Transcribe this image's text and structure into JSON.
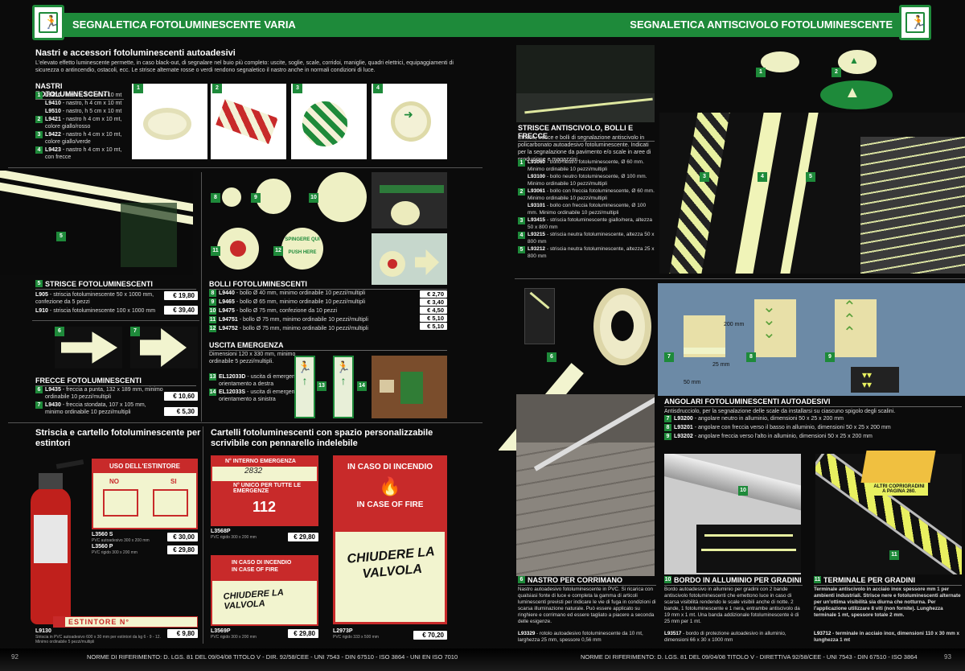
{
  "header": {
    "left_title": "SEGNALETICA FOTOLUMINESCENTE VARIA",
    "right_title": "SEGNALETICA ANTISCIVOLO FOTOLUMINESCENTE"
  },
  "intro": {
    "title": "Nastri e accessori fotoluminescenti autoadesivi",
    "text": "L'elevato effetto luminescente permette, in caso black-out, di segnalare nel buio più completo: uscite, soglie, scale, corridoi, maniglie, quadri elettrici, equipaggiamenti di sicurezza o antincendio, ostacoli, ecc. Le strisce alternate rosse o verdi rendono segnaletico il nastro anche in normali condizioni di luce."
  },
  "nastri": {
    "title": "NASTRI FOTOLUMINESCENTI",
    "items": [
      {
        "n": "1",
        "code": "L9210",
        "desc": "- nastro, h 2 cm x 10 mt"
      },
      {
        "n": "",
        "code": "L9410",
        "desc": "- nastro, h 4 cm x 10 mt"
      },
      {
        "n": "",
        "code": "L9510",
        "desc": "- nastro, h 5 cm x 10 mt"
      },
      {
        "n": "2",
        "code": "L9421",
        "desc": "- nastro h 4 cm x 10 mt, colore giallo/rosso"
      },
      {
        "n": "3",
        "code": "L9422",
        "desc": "- nastro h 4 cm x 10 mt, colore giallo/verde"
      },
      {
        "n": "4",
        "code": "L9423",
        "desc": "- nastro h 4 cm x 10 mt, con frecce"
      }
    ],
    "photo_tags": [
      "1",
      "2",
      "3",
      "4"
    ]
  },
  "strisce": {
    "tag": "5",
    "title": "STRISCE FOTOLUMINESCENTI",
    "items": [
      {
        "code": "L905",
        "desc": "- striscia fotoluminescente 50 x 1000 mm, confezione da 5 pezzi",
        "price": "€ 19,80"
      },
      {
        "code": "L910",
        "desc": "- striscia fotoluminescente 100 x 1000 mm",
        "price": "€ 39,40"
      }
    ]
  },
  "bolli": {
    "title": "BOLLI FOTOLUMINESCENTI",
    "tags": [
      "8",
      "9",
      "10",
      "11",
      "12"
    ],
    "push_text": "SPINGERE QUI",
    "push_text2": "PUSH HERE",
    "items": [
      {
        "n": "8",
        "code": "L9440",
        "desc": "- bollo Ø 40 mm, minimo ordinabile 10 pezzi/multipli",
        "price": "€ 2,70"
      },
      {
        "n": "9",
        "code": "L9465",
        "desc": "- bollo Ø 65 mm, minimo ordinabile 10 pezzi/multipli",
        "price": "€ 3,40"
      },
      {
        "n": "10",
        "code": "L9475",
        "desc": "- bollo Ø 75 mm, confezione da 10 pezzi",
        "price": "€ 4,50"
      },
      {
        "n": "11",
        "code": "L94751",
        "desc": "- bollo Ø 75 mm, minimo ordinabile 10 pezzi/multipli",
        "price": "€ 5,10"
      },
      {
        "n": "12",
        "code": "L94752",
        "desc": "- bollo Ø 75 mm, minimo ordinabile 10 pezzi/multipli",
        "price": "€ 5,10"
      }
    ]
  },
  "frecce": {
    "tags": [
      "6",
      "7"
    ],
    "title": "FRECCE FOTOLUMINESCENTI",
    "items": [
      {
        "n": "6",
        "code": "L9435",
        "desc": "- freccia a punta, 132 x 189 mm, minimo ordinabile 10 pezzi/multipli",
        "price": "€ 10,60"
      },
      {
        "n": "7",
        "code": "L9430",
        "desc": "- freccia stondata, 107 x 105 mm, minimo ordinabile 10 pezzi/multipli",
        "price": "€ 5,30"
      }
    ]
  },
  "uscita": {
    "title": "USCITA EMERGENZA",
    "text": "Dimensioni 120 x 330 mm, minimo ordinabile 5 pezzi/multipli.",
    "tags": [
      "13",
      "14"
    ],
    "items": [
      {
        "n": "13",
        "code": "EL12033D",
        "desc": "- uscita di emergenza, orientamento a destra"
      },
      {
        "n": "14",
        "code": "EL12033S",
        "desc": "- uscita di emergenza, orientamento a sinistra"
      }
    ]
  },
  "estintori": {
    "title": "Striscia e cartello fotoluminescente per estintori",
    "sign_title": "USO DELL'ESTINTORE",
    "no": "NO",
    "si": "SI",
    "tag": "ESTINTORE",
    "items": [
      {
        "code": "L3560 S",
        "desc": "PVC autoadesivo 300 x 200 mm",
        "price": "€ 30,00"
      },
      {
        "code": "L3560 P",
        "desc": "PVC rigido 300 x 200 mm",
        "price": "€ 29,80"
      }
    ],
    "strip": "ESTINTORE N°",
    "strip_code": "L9130",
    "strip_desc": "Striscia in PVC autoadesivo 600 x 30 mm per estintori da kg 6 - 9 - 12. Minimo ordinabile 5 pezzi/multipli",
    "strip_price": "€ 9,80"
  },
  "cartelli": {
    "title": "Cartelli fotoluminescenti con spazio personalizzabile scrivibile con pennarello indelebile",
    "s1": {
      "l1": "N° INTERNO EMERGENZA",
      "handwrite": "2832",
      "l2": "N° UNICO PER TUTTE LE EMERGENZE",
      "number": "112",
      "code": "L3568P",
      "desc": "PVC rigido 300 x 200 mm",
      "price": "€ 29,80"
    },
    "s2": {
      "l1": "IN CASO DI INCENDIO",
      "l2": "IN CASE OF FIRE",
      "handwrite": "CHIUDERE LA VALVOLA",
      "code": "L3569P",
      "desc": "PVC rigido 300 x 200 mm",
      "price": "€ 29,80"
    },
    "s3": {
      "l1": "IN CASO DI INCENDIO",
      "l2": "IN CASE OF FIRE",
      "handwrite": "CHIUDERE LA VALVOLA",
      "code": "L2973P",
      "desc": "PVC rigido 333 x 500 mm",
      "price": "€ 70,20"
    }
  },
  "antiscivolo": {
    "tags": [
      "1",
      "2",
      "3",
      "4",
      "5"
    ],
    "title": "STRISCE ANTISCIVOLO, BOLLI E FRECCE",
    "text": "Strisce, frecce e bolli di segnalazione antiscivolo in policarbonato autoadesivo fotoluminescente. Indicati per la segnalazione da pavimento e/o scale in aree di produzione e magazzini.",
    "items": [
      {
        "n": "1",
        "code": "L93060",
        "desc": "- bollo neutro fotoluminescente, Ø 60 mm. Minimo ordinabile 10 pezzi/multipli"
      },
      {
        "n": "",
        "code": "L93100",
        "desc": "- bollo neutro fotoluminescente, Ø 100 mm. Minimo ordinabile 10 pezzi/multipli"
      },
      {
        "n": "2",
        "code": "L93061",
        "desc": "- bollo con freccia fotoluminescente, Ø 60 mm. Minimo ordinabile 10 pezzi/multipli"
      },
      {
        "n": "",
        "code": "L93101",
        "desc": "- bollo con freccia fotoluminescente, Ø 100 mm. Minimo ordinabile 10 pezzi/multipli"
      },
      {
        "n": "3",
        "code": "L93415",
        "desc": "- striscia fotoluminescente giallo/nera, altezza 50 x 800 mm"
      },
      {
        "n": "4",
        "code": "L93215",
        "desc": "- striscia neutra fotoluminescente, altezza 50 x 800 mm"
      },
      {
        "n": "5",
        "code": "L93212",
        "desc": "- striscia neutra fotoluminescente, altezza 25 x 800 mm"
      }
    ]
  },
  "angolari": {
    "tags": [
      "7",
      "8",
      "9"
    ],
    "dims": [
      "200 mm",
      "25 mm",
      "50 mm"
    ],
    "title": "ANGOLARI FOTOLUMINESCENTI AUTOADESIVI",
    "text": "Antisdrucciolo, per la segnalazione delle scale da installarsi su ciascuno spigolo degli scalini.",
    "items": [
      {
        "n": "7",
        "code": "L93200",
        "desc": "- angolare neutro in alluminio, dimensioni 50 x 25 x 200 mm"
      },
      {
        "n": "8",
        "code": "L93201",
        "desc": "- angolare con freccia verso il basso in alluminio, dimensioni 50 x 25 x 200 mm"
      },
      {
        "n": "9",
        "code": "L93202",
        "desc": "- angolare freccia verso l'alto in alluminio, dimensioni 50 x 25 x 200 mm"
      }
    ]
  },
  "corrimano": {
    "tag": "6",
    "n": "6",
    "title": "NASTRO PER CORRIMANO",
    "text": "Nastro autoadesivo fotoluminescente in PVC. Si ricarica con qualsiasi fonte di luce e completa la gamma di articoli luminescenti previsti per indicare le vie di fuga in condizioni di scarsa illuminazione naturale. Può essere applicato su ringhiere e corrimano ed essere tagliato a piacere a seconda delle esigenze.",
    "code": "L93329",
    "desc": "- rotolo autoadesivo fotoluminescente da 10 mt, larghezza 25 mm, spessore 0,56 mm"
  },
  "bordo": {
    "tag": "10",
    "n": "10",
    "title": "BORDO IN ALLUMINIO PER GRADINI",
    "text": "Bordo autoadesivo in alluminio per gradini con 2 bande antiscivolo fotoluminescenti che emettono luce in caso di scarsa visibilità rendendo le scale visibili anche di notte. 2 bande, 1 fotoluminescente e 1 nera, entrambe antiscivolo da 19 mm x 1 mt. Una banda addizionale fotoluminescente è di 25 mm per 1 mt.",
    "code": "L93517",
    "desc": "- bordo di protezione autoadesivo in alluminio, dimensioni 66 x 30 x 1000 mm"
  },
  "terminale": {
    "tag": "11",
    "n": "11",
    "title": "TERMINALE PER GRADINI",
    "callout": "ALTRI COPRIGRADINI A PAGINA 260.",
    "text": "Terminale antiscivolo in acciaio inox spessore mm 1 per ambienti industriali. Strisce nere e fotoluminescenti alternate per un'ottima visibilità sia diurna che notturna. Per l'applicazione utilizzare 8 viti (non fornite). Lunghezza terminale 1 mt, spessore totale 2 mm.",
    "code": "L93712",
    "desc": "- terminale in acciaio inox, dimensioni 110 x 30 mm x lunghezza 1 mt"
  },
  "footer": {
    "page_left": "92",
    "page_right": "93",
    "norm_left": "NORME DI RIFERIMENTO: D. LGS. 81 DEL 09/04/08 TITOLO V - DIR. 92/58/CEE - UNI 7543 - DIN 67510 - ISO 3864 - UNI EN ISO 7010",
    "norm_right": "NORME DI RIFERIMENTO: D. LGS. 81 DEL 09/04/08 TITOLO V - DIRETTIVA 92/58/CEE - UNI 7543 - DIN 67510 - ISO 3864"
  },
  "colors": {
    "brand_green": "#1e8a3a",
    "glow": "#f2f4cf",
    "price_bg": "#ffffff"
  }
}
